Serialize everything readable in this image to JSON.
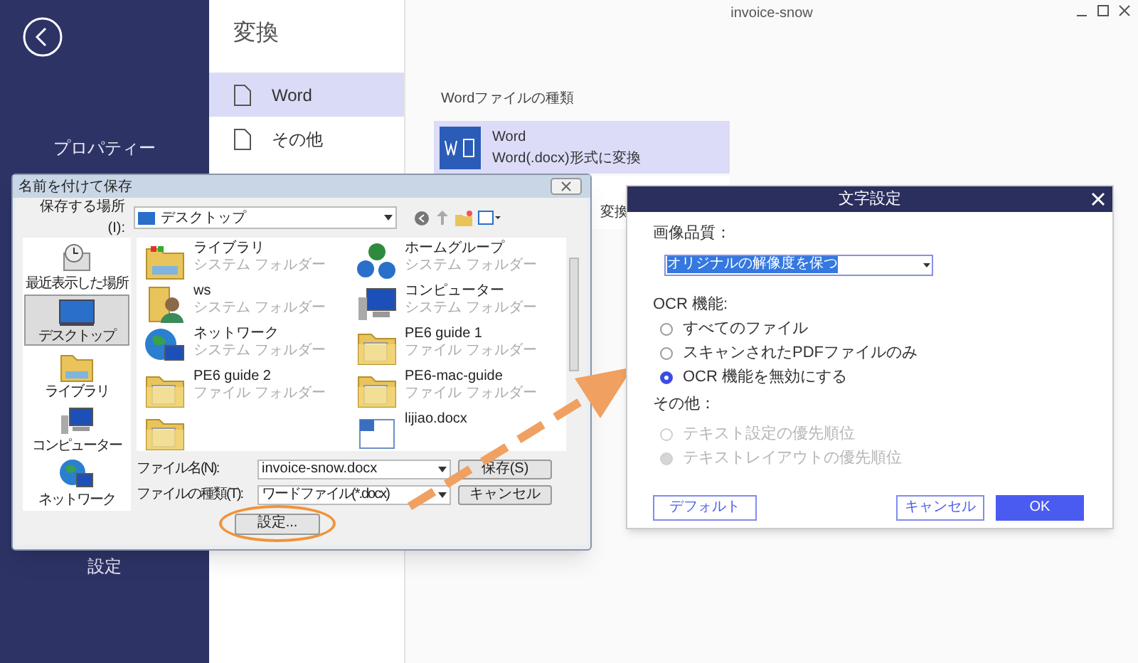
{
  "app": {
    "title": "invoice-snow",
    "sidebar": {
      "items": [
        {
          "label": "プロパティー"
        },
        {
          "label": "設定"
        }
      ]
    },
    "convert": {
      "heading": "変換",
      "formats": [
        {
          "label": "Word",
          "selected": true
        },
        {
          "label": "その他",
          "selected": false
        }
      ]
    },
    "options": {
      "heading": "Wordファイルの種類",
      "items": [
        {
          "title": "Word",
          "subtitle": "Word(.docx)形式に変換",
          "selected": true
        },
        {
          "subtitle": "変換",
          "selected": false
        }
      ]
    }
  },
  "save_dialog": {
    "title": "名前を付けて保存",
    "location_label": "保存する場所(I):",
    "location": "デスクトップ",
    "places": [
      {
        "label": "最近表示した場所",
        "kind": "recent",
        "selected": false
      },
      {
        "label": "デスクトップ",
        "kind": "desktop",
        "selected": true
      },
      {
        "label": "ライブラリ",
        "kind": "library",
        "selected": false
      },
      {
        "label": "コンピューター",
        "kind": "computer",
        "selected": false
      },
      {
        "label": "ネットワーク",
        "kind": "network",
        "selected": false
      }
    ],
    "files": [
      {
        "name": "ライブラリ",
        "type": "システム フォルダー",
        "kind": "library"
      },
      {
        "name": "ホームグループ",
        "type": "システム フォルダー",
        "kind": "homegroup"
      },
      {
        "name": "ws",
        "type": "システム フォルダー",
        "kind": "user"
      },
      {
        "name": "コンピューター",
        "type": "システム フォルダー",
        "kind": "computer"
      },
      {
        "name": "ネットワーク",
        "type": "システム フォルダー",
        "kind": "network"
      },
      {
        "name": "PE6 guide 1",
        "type": "ファイル フォルダー",
        "kind": "folder"
      },
      {
        "name": "PE6 guide 2",
        "type": "ファイル フォルダー",
        "kind": "folder"
      },
      {
        "name": "PE6-mac-guide",
        "type": "ファイル フォルダー",
        "kind": "folder"
      },
      {
        "kind": "folder"
      },
      {
        "name": "lijiao.docx",
        "kind": "document"
      }
    ],
    "filename_label": "ファイル名(N):",
    "filename": "invoice-snow.docx",
    "save_button": "保存(S)",
    "filetype_label": "ファイルの種類(T):",
    "filetype": "ワードファイル(*.docx)",
    "cancel_button": "キャンセル",
    "settings_button": "設定..."
  },
  "text_dialog": {
    "title": "文字設定",
    "quality_label": "画像品質：",
    "quality": "オリジナルの解像度を保つ",
    "ocr_label": "OCR 機能:",
    "ocr_options": [
      {
        "label": "すべてのファイル",
        "selected": false,
        "disabled": false
      },
      {
        "label": "スキャンされたPDFファイルのみ",
        "selected": false,
        "disabled": false
      },
      {
        "label": "OCR 機能を無効にする",
        "selected": true,
        "disabled": false
      }
    ],
    "other_label": "その他：",
    "other_options": [
      {
        "label": "テキスト設定の優先順位",
        "selected": false,
        "disabled": true
      },
      {
        "label": "テキストレイアウトの優先順位",
        "selected": true,
        "disabled": true
      }
    ],
    "buttons": [
      {
        "label": "デフォルト",
        "kind": "outline"
      },
      {
        "label": "キャンセル",
        "kind": "outline"
      },
      {
        "label": "OK",
        "kind": "primary"
      }
    ]
  }
}
